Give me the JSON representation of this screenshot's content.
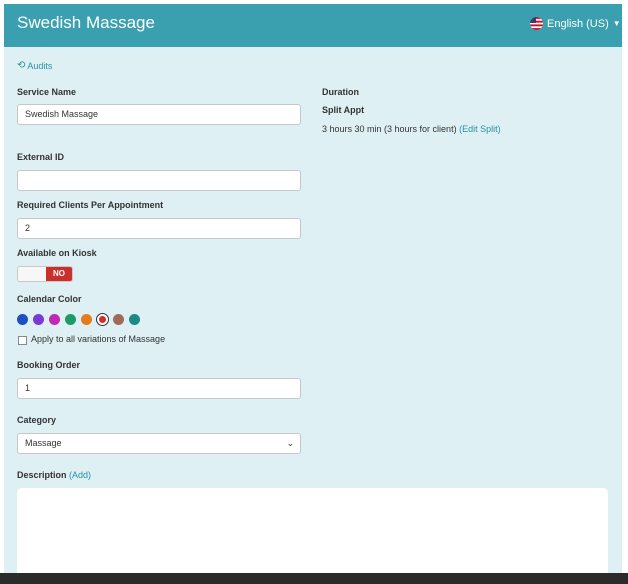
{
  "header": {
    "title": "Swedish Massage",
    "language": "English (US)",
    "language_icon": "us-flag-icon"
  },
  "audits_label": "Audits",
  "service_name": {
    "label": "Service Name",
    "value": "Swedish Massage"
  },
  "duration": {
    "label": "Duration",
    "split_label": "Split Appt",
    "split_text": "3 hours 30 min (3 hours for client)",
    "edit_split": "(Edit Split)"
  },
  "external_id": {
    "label": "External ID",
    "value": ""
  },
  "required_clients": {
    "label": "Required Clients Per Appointment",
    "value": "2"
  },
  "kiosk": {
    "label": "Available on Kiosk",
    "state_label": "NO"
  },
  "calendar_color": {
    "label": "Calendar Color",
    "colors": [
      "#1f4fc4",
      "#7a3ad6",
      "#c227b8",
      "#1e9a6a",
      "#e57b1a",
      "#d12e2e",
      "#a06a5a",
      "#1b8a86"
    ],
    "selected_index": 5,
    "apply_all_label": "Apply to all variations of Massage"
  },
  "booking_order": {
    "label": "Booking Order",
    "value": "1"
  },
  "category": {
    "label": "Category",
    "value": "Massage"
  },
  "description": {
    "label": "Description",
    "add_link": "(Add)"
  }
}
